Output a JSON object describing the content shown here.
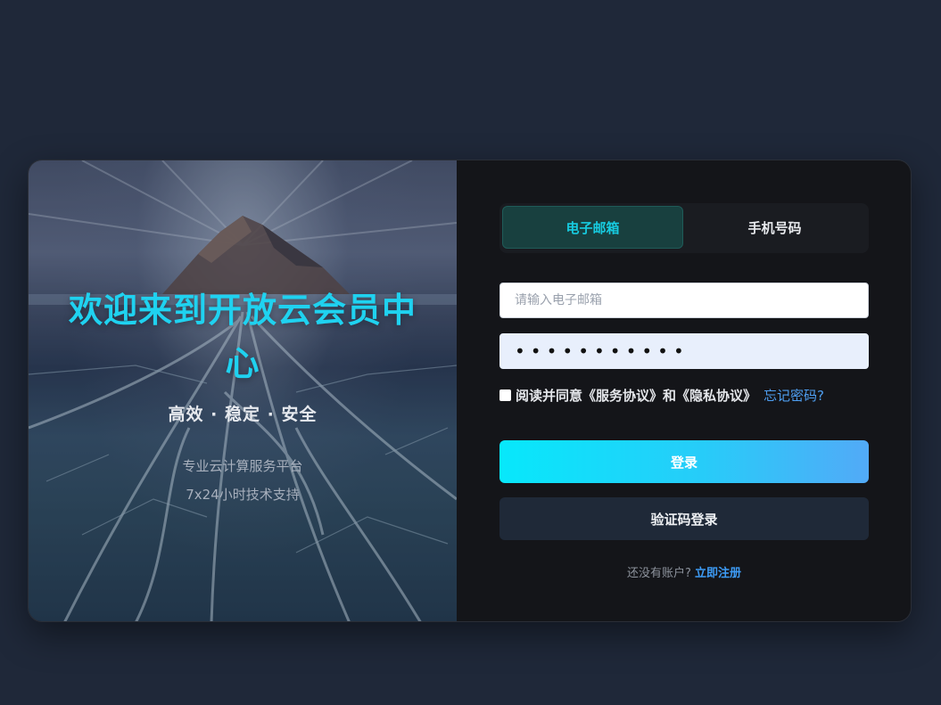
{
  "hero": {
    "title": "欢迎来到开放云会员中心",
    "tagline": "高效 · 稳定 · 安全",
    "sub_lines": [
      "专业云计算服务平台",
      "7x24小时技术支持"
    ]
  },
  "tabs": [
    {
      "label": "电子邮箱",
      "active": true
    },
    {
      "label": "手机号码",
      "active": false
    }
  ],
  "form": {
    "email_placeholder": "请输入电子邮箱",
    "email_value": "",
    "password_value": "•••••••••••",
    "agree_checked": false,
    "agree_text": "阅读并同意《服务协议》和《隐私协议》",
    "forgot_link": "忘记密码?"
  },
  "buttons": {
    "login": "登录",
    "code_login": "验证码登录"
  },
  "footer": {
    "no_account_text": "还没有账户?",
    "register_link": "立即注册"
  },
  "colors": {
    "accent": "#1fd2f0",
    "link": "#3d9bf5",
    "page_bg": "#1f2839",
    "card_bg": "#141519"
  }
}
